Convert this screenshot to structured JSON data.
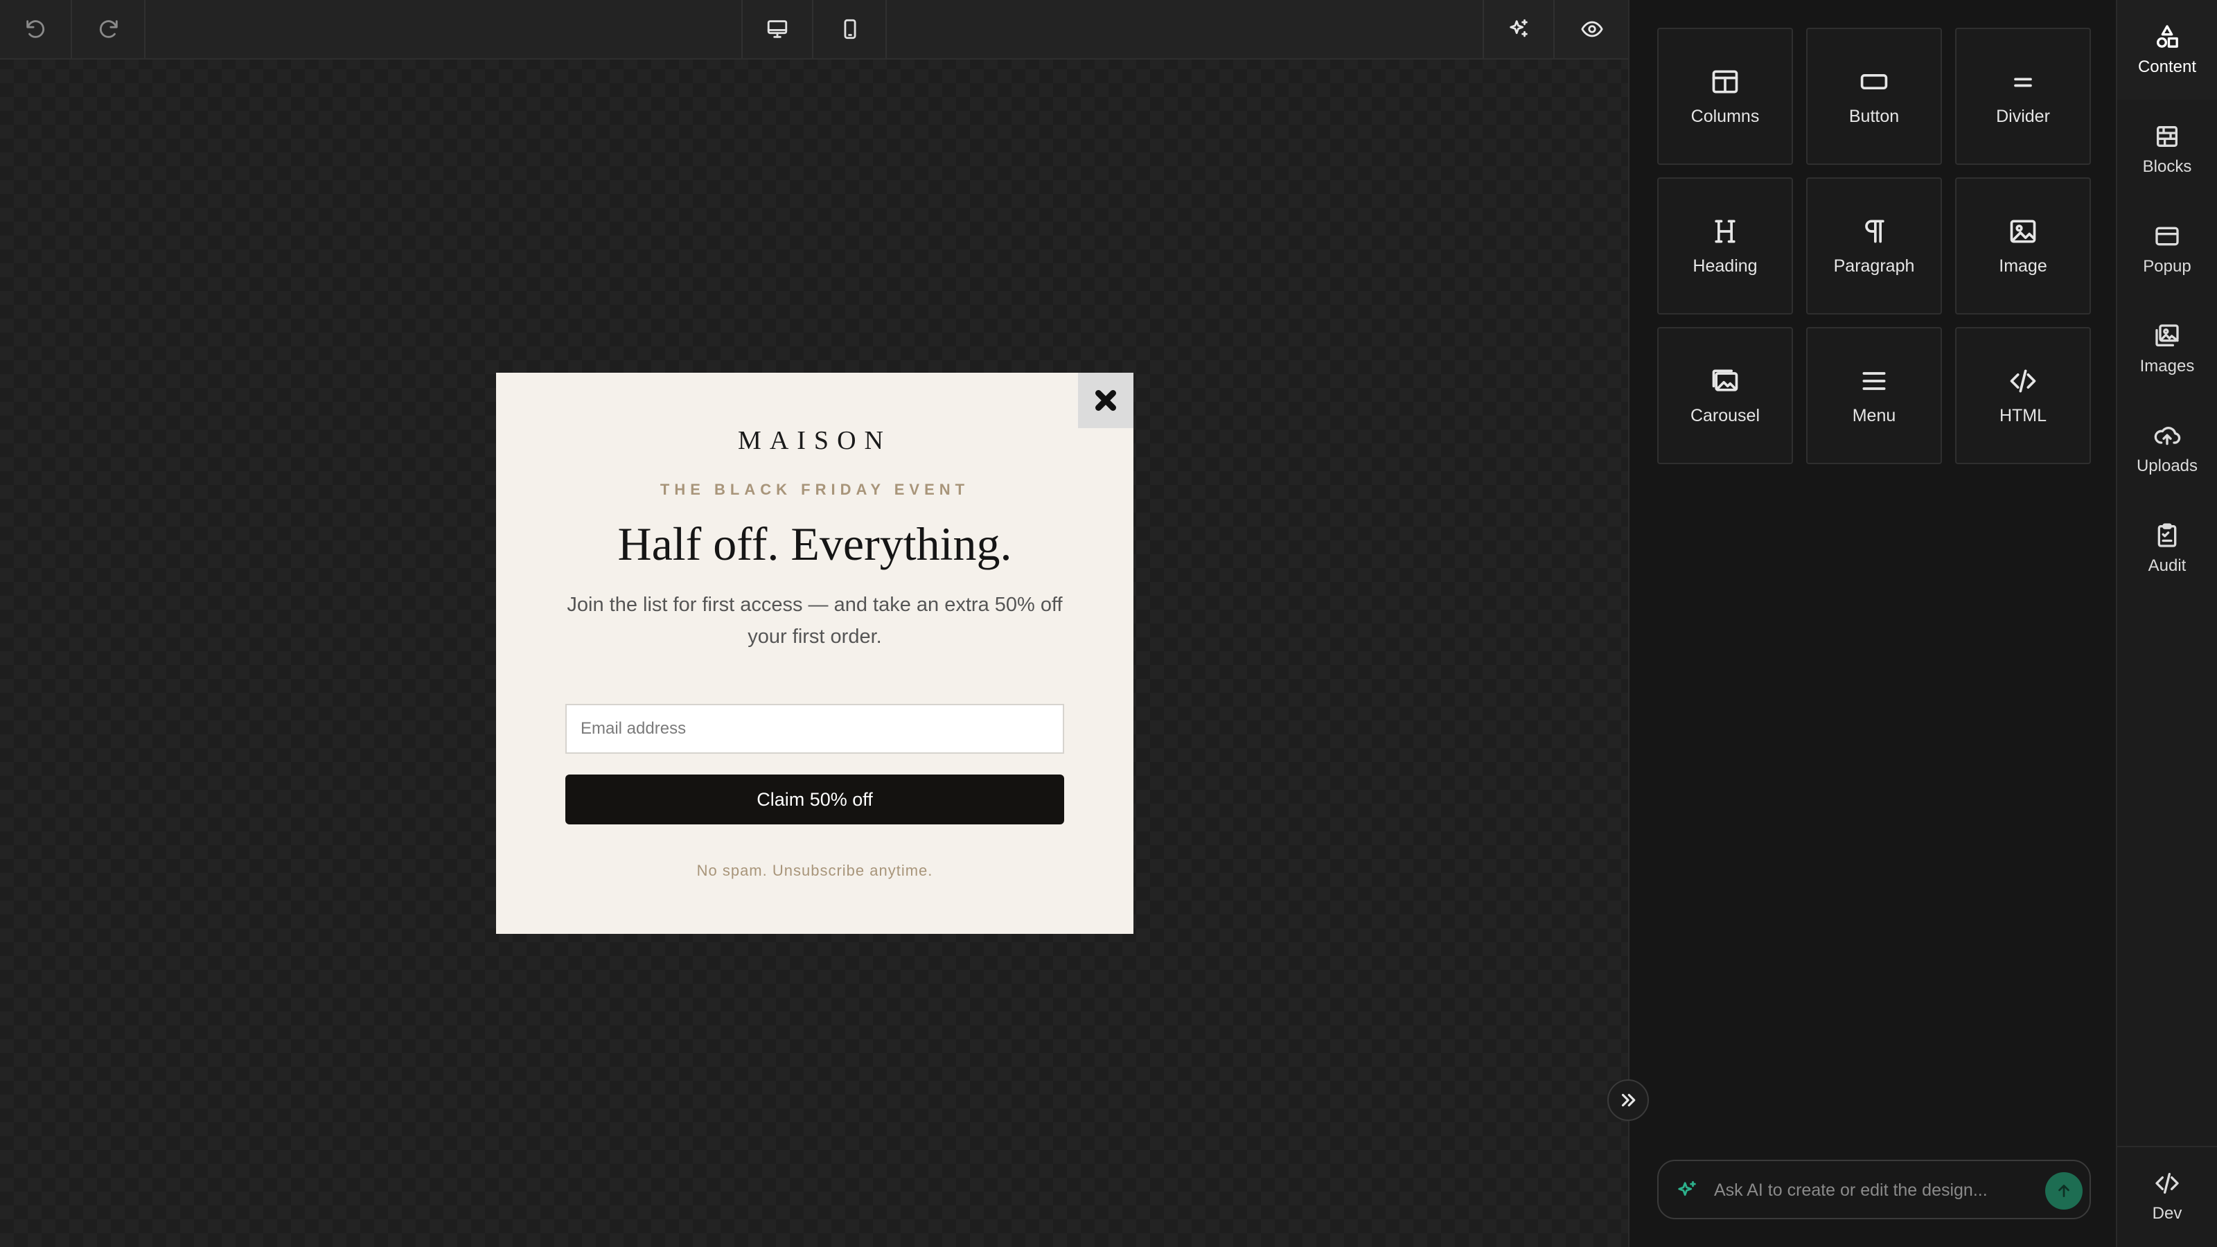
{
  "toolbar": {
    "undo_icon": "undo-icon",
    "redo_icon": "redo-icon",
    "desktop_icon": "monitor-icon",
    "mobile_icon": "smartphone-icon",
    "ai_icon": "sparkles-icon",
    "preview_icon": "eye-icon"
  },
  "popup": {
    "brand": "MAISON",
    "eyebrow": "THE BLACK FRIDAY EVENT",
    "headline": "Half off. Everything.",
    "body": "Join the list for first access — and take an extra 50% off your first order.",
    "email_placeholder": "Email address",
    "email_value": "",
    "submit_label": "Claim 50% off",
    "footnote": "No spam. Unsubscribe anytime.",
    "close_icon": "close-icon",
    "background": "#f5f1eb",
    "accent": "#a8957a",
    "button_color": "#141210"
  },
  "panel": {
    "tiles": [
      {
        "label": "Columns",
        "icon": "columns-icon"
      },
      {
        "label": "Button",
        "icon": "button-icon"
      },
      {
        "label": "Divider",
        "icon": "divider-icon"
      },
      {
        "label": "Heading",
        "icon": "heading-icon"
      },
      {
        "label": "Paragraph",
        "icon": "paragraph-icon"
      },
      {
        "label": "Image",
        "icon": "image-icon"
      },
      {
        "label": "Carousel",
        "icon": "carousel-icon"
      },
      {
        "label": "Menu",
        "icon": "menu-icon"
      },
      {
        "label": "HTML",
        "icon": "code-icon"
      }
    ],
    "ai": {
      "placeholder": "Ask AI to create or edit the design...",
      "value": "",
      "accent": "#2cb08b"
    }
  },
  "rail": {
    "items": [
      {
        "label": "Content",
        "icon": "shapes-icon",
        "active": true
      },
      {
        "label": "Blocks",
        "icon": "blocks-icon"
      },
      {
        "label": "Popup",
        "icon": "popup-icon"
      },
      {
        "label": "Images",
        "icon": "images-icon"
      },
      {
        "label": "Uploads",
        "icon": "upload-cloud-icon"
      },
      {
        "label": "Audit",
        "icon": "clipboard-check-icon"
      }
    ],
    "dev": {
      "label": "Dev",
      "icon": "code-icon"
    }
  }
}
